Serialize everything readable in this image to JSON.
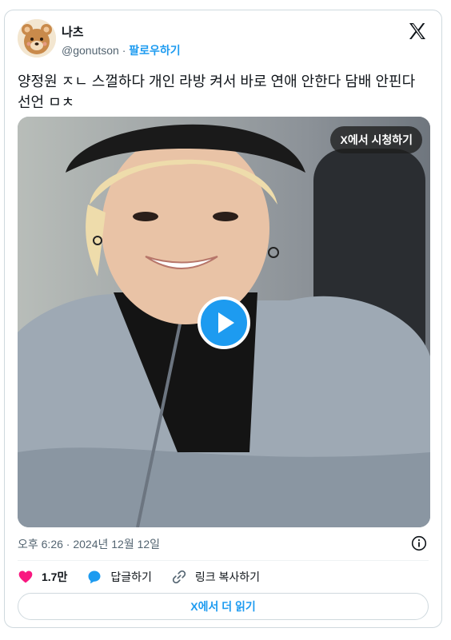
{
  "user": {
    "display_name": "나츠",
    "handle": "@gonutson",
    "separator": "·",
    "follow_label": "팔로우하기"
  },
  "tweet": {
    "text": "양정원 ㅈㄴ 스껄하다 개인 라방 켜서 바로 연애 안한다 담배 안핀다 선언 ㅁㅊ",
    "timestamp": "오후 6:26 · 2024년 12월 12일"
  },
  "media": {
    "watch_label": "X에서 시청하기",
    "play_icon": "play-icon"
  },
  "actions": {
    "like_count": "1.7만",
    "reply_label": "답글하기",
    "copy_link_label": "링크 복사하기"
  },
  "read_more_label": "X에서 더 읽기",
  "colors": {
    "accent": "#1d9bf0",
    "like": "#f91880",
    "text": "#0f1419",
    "secondary": "#536471",
    "border": "#cfd9de"
  }
}
